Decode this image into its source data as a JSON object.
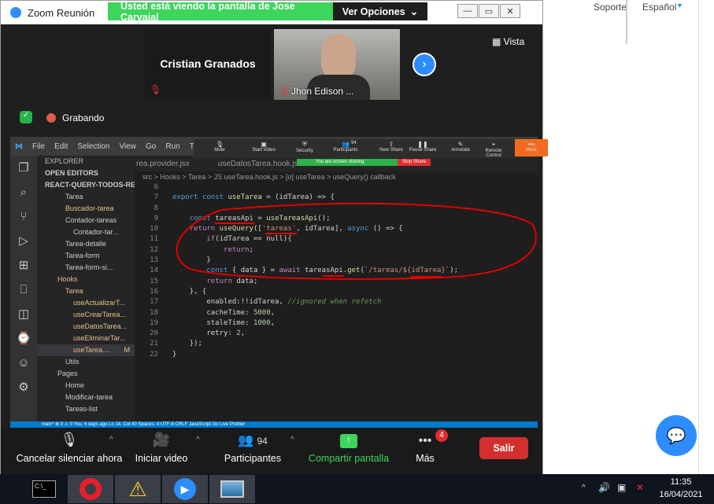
{
  "window": {
    "title": "Zoom Reunión",
    "banner_text": "Usted está viendo la pantalla de Jose Carvajal",
    "view_options": "Ver Opciones"
  },
  "background_page": {
    "support_link": "Soporte",
    "language": "Español"
  },
  "participants_strip": {
    "participant1": "Cristian Granados",
    "participant2": "Jhon Edison ...",
    "view_label": "Vista"
  },
  "recording": {
    "label": "Grabando"
  },
  "vscode": {
    "menu": [
      "File",
      "Edit",
      "Selection",
      "View",
      "Go",
      "Run",
      "Term"
    ],
    "tabs": [
      "rea.provider.jsx",
      "useDatosTarea.hook.js"
    ],
    "breadcrumb": "src > Hooks > Tarea > JS useTarea.hook.js > [o] useTarea > useQuery() callback",
    "explorer_title": "EXPLORER",
    "open_editors": "OPEN EDITORS",
    "project": "REACT-QUERY-TODOS-REF...",
    "tree": [
      "Tarea",
      "Buscador-tarea",
      "Contador-tareas",
      "Contador-tar...",
      "Tarea-detalle",
      "Tarea-form",
      "Tarea-form-si...",
      "Hooks",
      "Tarea",
      "useActualizarT...",
      "useCrearTarea...",
      "useDatosTarea...",
      "useEliminarTar...",
      "useTarea....",
      "Utils",
      "Pages",
      "Home",
      "Modificar-tarea",
      "Tareas-list"
    ],
    "active_badge": "M",
    "code": [
      {
        "n": "6",
        "t": ""
      },
      {
        "n": "7",
        "t": "export const useTarea = (idTarea) => {"
      },
      {
        "n": "8",
        "t": ""
      },
      {
        "n": "9",
        "t": "    const tareasApi = useTareasApi();"
      },
      {
        "n": "10",
        "t": "    return useQuery(['tareas', idTarea], async () => {"
      },
      {
        "n": "11",
        "t": "        if(idTarea == null){"
      },
      {
        "n": "12",
        "t": "            return;"
      },
      {
        "n": "13",
        "t": "        }"
      },
      {
        "n": "14",
        "t": "        const { data } = await tareasApi.get(`/tareas/${idTarea}`);"
      },
      {
        "n": "15",
        "t": "        return data;"
      },
      {
        "n": "16",
        "t": "    }, {"
      },
      {
        "n": "17",
        "t": "        enabled:!!idTarea, //ignored when refetch"
      },
      {
        "n": "18",
        "t": "        cacheTime: 5000,"
      },
      {
        "n": "19",
        "t": "        staleTime: 1000,"
      },
      {
        "n": "20",
        "t": "        retry: 2,"
      },
      {
        "n": "21",
        "t": "    });"
      },
      {
        "n": "22",
        "t": "}"
      }
    ],
    "statusbar": "main*   ⊗ 0 ⚠ 0    You, 6 days ago   Ln 14, Col 40   Spaces: 4   UTF-8   CRLF   JavaScript   Go Live   Prettier"
  },
  "presenter_toolbar": {
    "items": [
      "Mute",
      "Start Video",
      "Security",
      "Participants",
      "New Share",
      "Pause Share",
      "Annotate",
      "Remote Control",
      "More"
    ],
    "participants_count": "94",
    "sharing_text": "You are screen sharing",
    "stop_share": "Stop Share"
  },
  "bottom_bar": {
    "unmute": "Cancelar silenciar ahora",
    "video": "Iniciar video",
    "participants": "Participantes",
    "participants_count": "94",
    "share": "Compartir pantalla",
    "more": "Más",
    "more_badge": "4",
    "leave": "Salir"
  },
  "taskbar": {
    "time": "11:35",
    "date": "16/04/2021"
  },
  "colors": {
    "zoom_green": "#3dd55b",
    "leave_red": "#d32f2f",
    "annotation_red": "#e00000",
    "chat_blue": "#2d8cff"
  }
}
